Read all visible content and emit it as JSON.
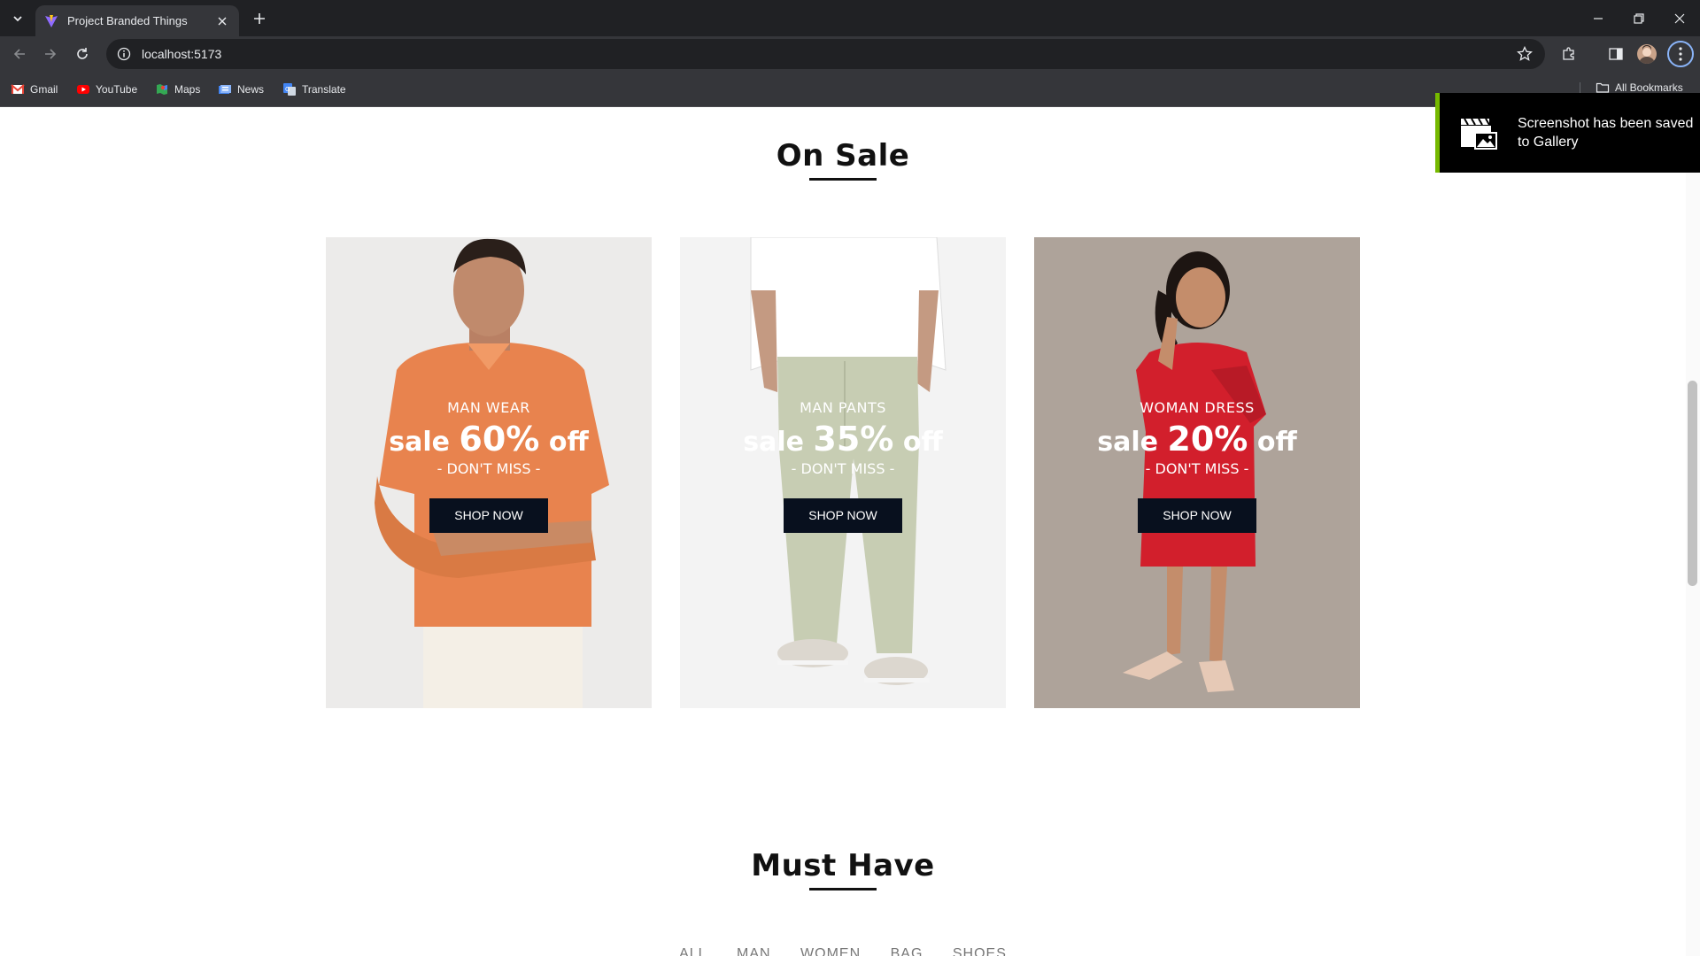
{
  "browser": {
    "tab_title": "Project Branded Things",
    "url": "localhost:5173",
    "bookmarks": [
      "Gmail",
      "YouTube",
      "Maps",
      "News",
      "Translate"
    ],
    "all_bookmarks": "All Bookmarks"
  },
  "on_sale": {
    "title": "On Sale",
    "cards": [
      {
        "category": "MAN WEAR",
        "sale_prefix": "sale",
        "percent": "60%",
        "sale_suffix": "off",
        "tagline": "- DON'T MISS -",
        "button": "SHOP NOW"
      },
      {
        "category": "MAN PANTS",
        "sale_prefix": "sale",
        "percent": "35%",
        "sale_suffix": "off",
        "tagline": "- DON'T MISS -",
        "button": "SHOP NOW"
      },
      {
        "category": "WOMAN DRESS",
        "sale_prefix": "sale",
        "percent": "20%",
        "sale_suffix": "off",
        "tagline": "- DON'T MISS -",
        "button": "SHOP NOW"
      }
    ]
  },
  "must_have": {
    "title": "Must Have",
    "filters": [
      "ALL",
      "MAN",
      "WOMEN",
      "BAG",
      "SHOES"
    ]
  },
  "toast": {
    "message": "Screenshot has been saved to Gallery"
  }
}
